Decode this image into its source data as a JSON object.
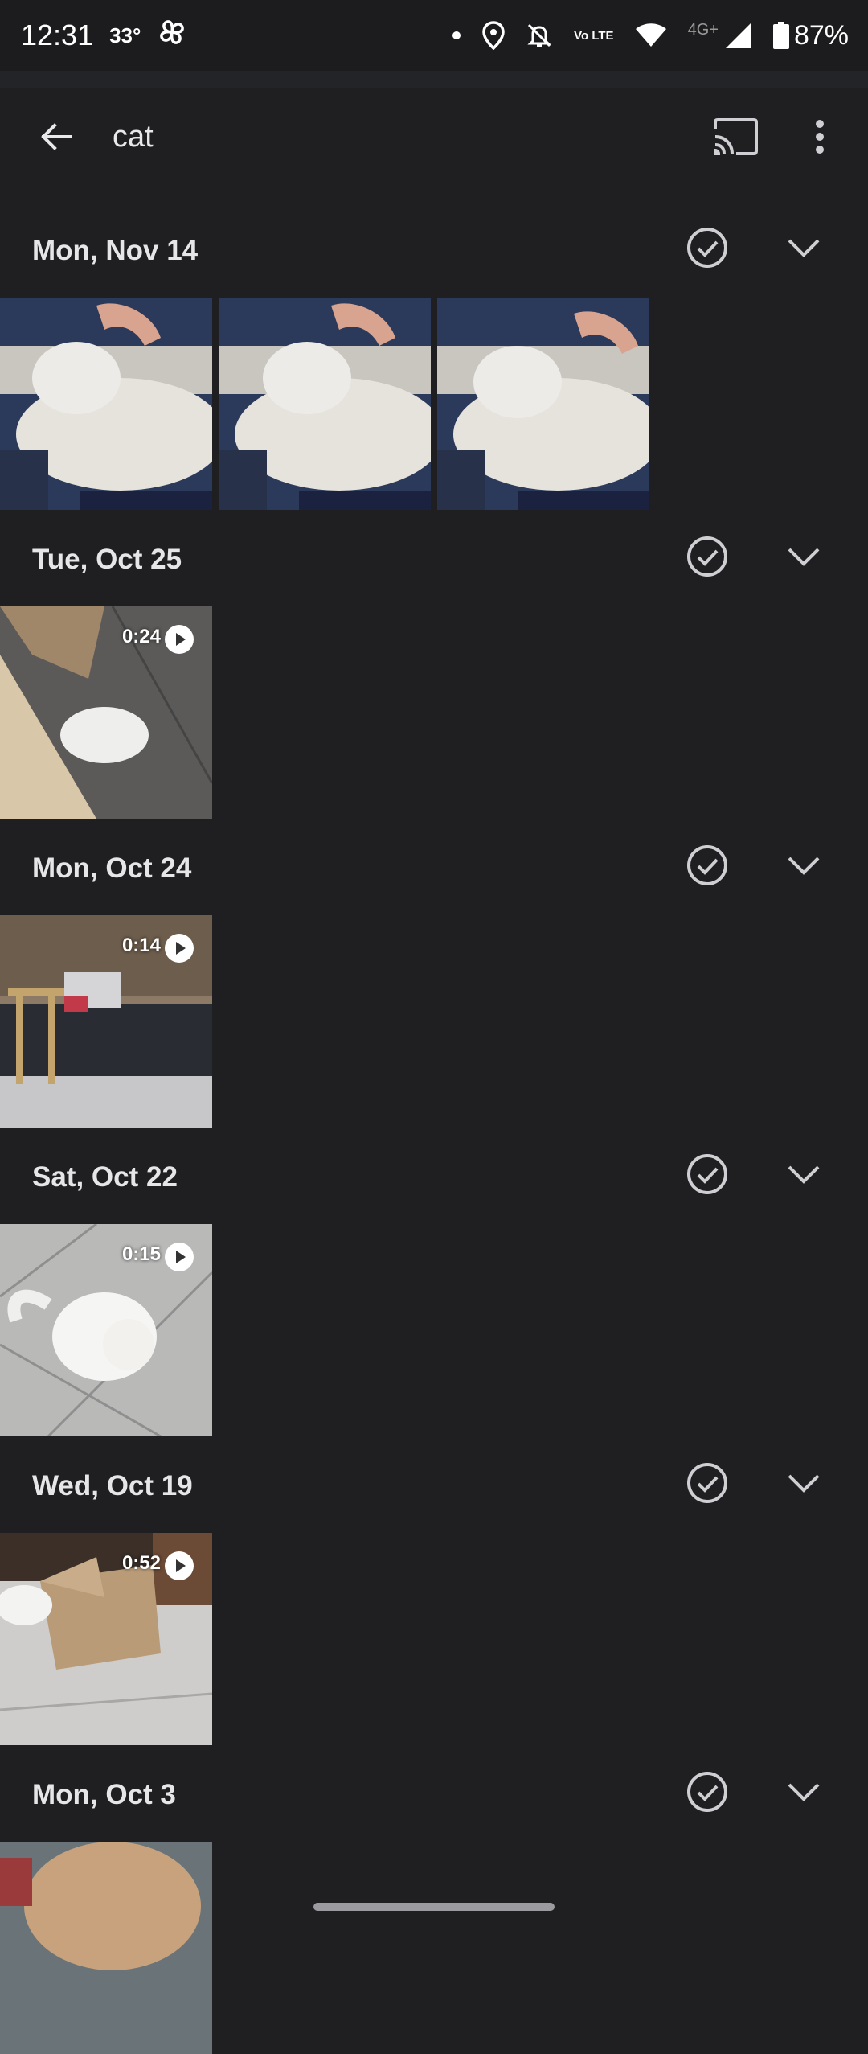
{
  "status_bar": {
    "time": "12:31",
    "temperature": "33°",
    "network": "4G+",
    "volte": "Vo LTE",
    "battery": "87%",
    "icons": [
      "fan-icon",
      "dot-icon",
      "location-icon",
      "alarm-off-icon",
      "volte-icon",
      "wifi-icon",
      "signal-icon",
      "battery-icon"
    ]
  },
  "toolbar": {
    "search_query": "cat",
    "back_icon": "arrow-back-icon",
    "cast_icon": "cast-icon",
    "more_icon": "more-vert-icon"
  },
  "sections": [
    {
      "date": "Mon, Nov 14",
      "items": [
        {
          "type": "photo"
        },
        {
          "type": "photo"
        },
        {
          "type": "photo"
        }
      ]
    },
    {
      "date": "Tue, Oct 25",
      "items": [
        {
          "type": "video",
          "duration": "0:24"
        }
      ]
    },
    {
      "date": "Mon, Oct 24",
      "items": [
        {
          "type": "video",
          "duration": "0:14"
        }
      ]
    },
    {
      "date": "Sat, Oct 22",
      "items": [
        {
          "type": "video",
          "duration": "0:15"
        }
      ]
    },
    {
      "date": "Wed, Oct 19",
      "items": [
        {
          "type": "video",
          "duration": "0:52"
        }
      ]
    },
    {
      "date": "Mon, Oct 3",
      "items": [
        {
          "type": "photo"
        }
      ]
    }
  ],
  "colors": {
    "background": "#1f1f21",
    "text": "#e8e8ea",
    "icon": "#cfcfd3"
  }
}
